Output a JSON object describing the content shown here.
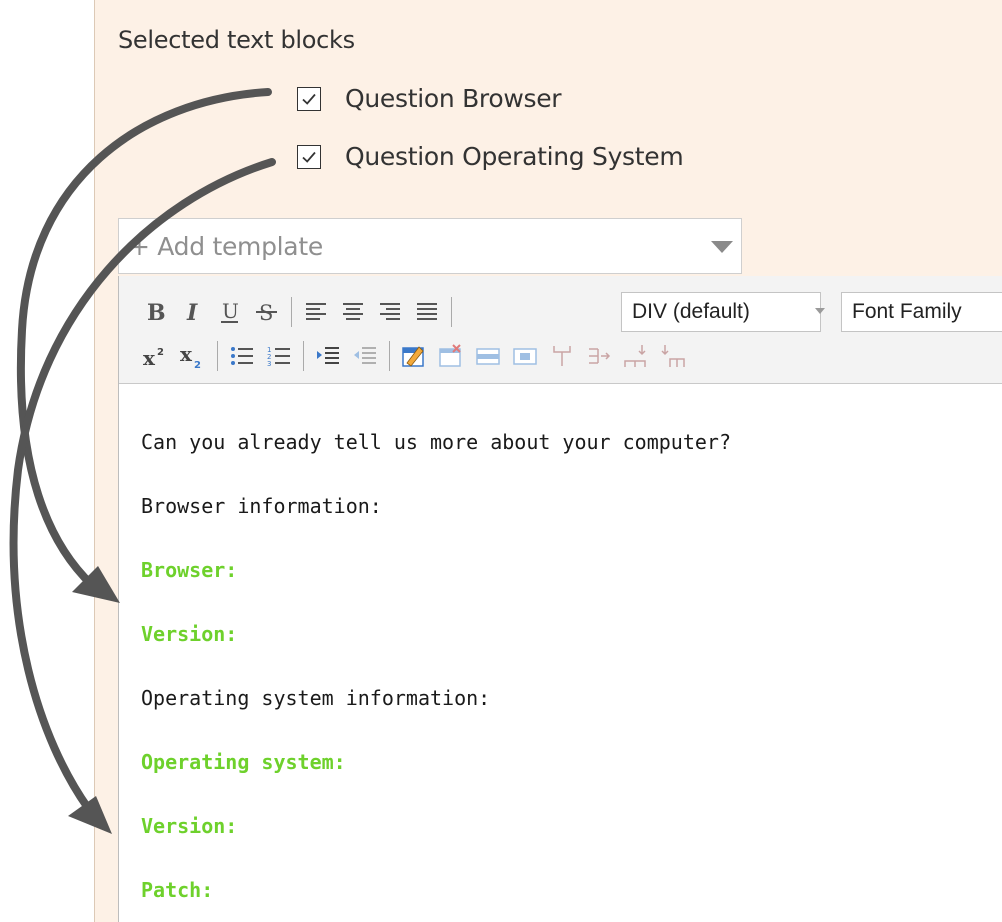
{
  "section": {
    "title": "Selected text blocks"
  },
  "text_blocks": [
    {
      "label": "Question Browser",
      "checked": true
    },
    {
      "label": "Question Operating System",
      "checked": true
    }
  ],
  "template_select": {
    "placeholder": "+ Add template"
  },
  "toolbar": {
    "row1_icons": [
      "bold-icon",
      "italic-icon",
      "underline-icon",
      "strikethrough-icon",
      "align-left-icon",
      "align-center-icon",
      "align-right-icon",
      "justify-icon"
    ],
    "block_format": "DIV (default)",
    "font_family": "Font Family",
    "row2_icons": [
      "superscript-icon",
      "subscript-icon",
      "bullet-list-icon",
      "numbered-list-icon",
      "indent-icon",
      "outdent-icon",
      "insert-table-icon",
      "delete-table-icon",
      "row-icon",
      "cell-icon",
      "split-icon",
      "insert-after-icon",
      "insert-above-icon",
      "insert-below-icon"
    ]
  },
  "editor": {
    "lines": [
      {
        "text": "Can you already tell us more about your computer?",
        "placeholder": false
      },
      {
        "text": "Browser information:",
        "placeholder": false
      },
      {
        "text": "Browser:",
        "placeholder": true
      },
      {
        "text": "Version:",
        "placeholder": true
      },
      {
        "text": "Operating system information:",
        "placeholder": false
      },
      {
        "text": "Operating system:",
        "placeholder": true
      },
      {
        "text": "Version:",
        "placeholder": true
      },
      {
        "text": "Patch:",
        "placeholder": true
      }
    ]
  },
  "colors": {
    "panel_background": "#fdf1e6",
    "placeholder_green": "#6ed12c",
    "arrow": "#555555"
  }
}
